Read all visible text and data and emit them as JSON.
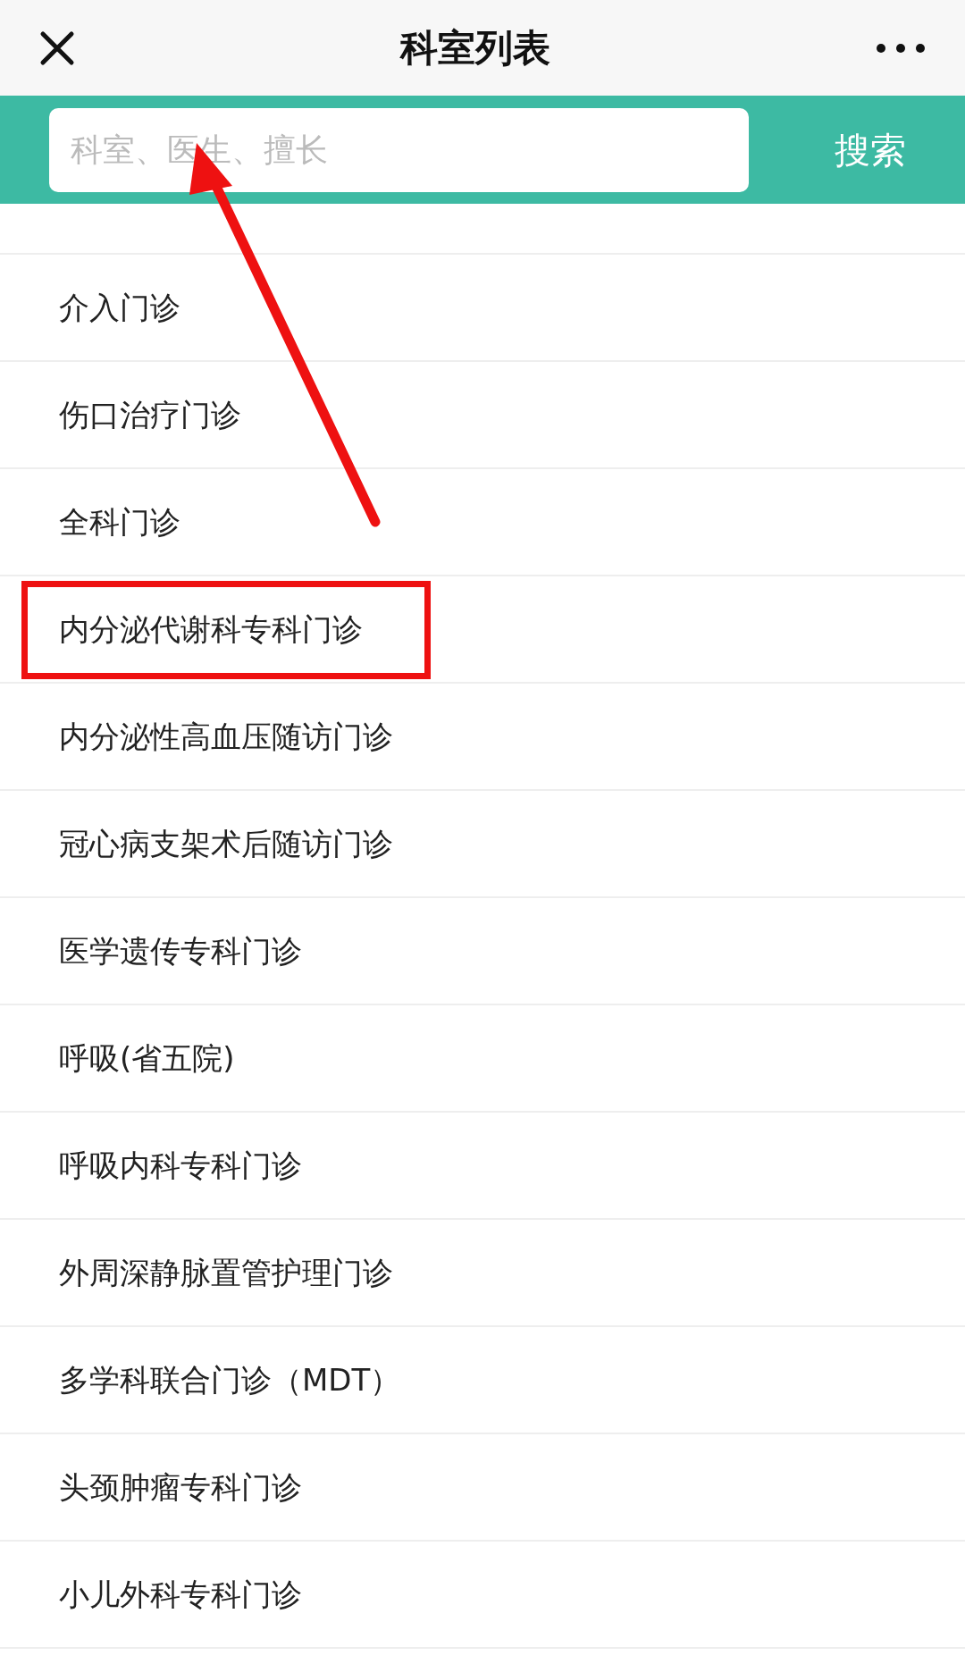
{
  "header": {
    "title": "科室列表"
  },
  "search": {
    "placeholder": "科室、医生、擅长",
    "button": "搜索"
  },
  "departments": [
    {
      "name": "介入门诊",
      "highlighted": false
    },
    {
      "name": "伤口治疗门诊",
      "highlighted": false
    },
    {
      "name": "全科门诊",
      "highlighted": false
    },
    {
      "name": "内分泌代谢科专科门诊",
      "highlighted": true
    },
    {
      "name": "内分泌性高血压随访门诊",
      "highlighted": false
    },
    {
      "name": "冠心病支架术后随访门诊",
      "highlighted": false
    },
    {
      "name": "医学遗传专科门诊",
      "highlighted": false
    },
    {
      "name": "呼吸(省五院)",
      "highlighted": false
    },
    {
      "name": "呼吸内科专科门诊",
      "highlighted": false
    },
    {
      "name": "外周深静脉置管护理门诊",
      "highlighted": false
    },
    {
      "name": "多学科联合门诊（MDT）",
      "highlighted": false
    },
    {
      "name": "头颈肿瘤专科门诊",
      "highlighted": false
    },
    {
      "name": "小儿外科专科门诊",
      "highlighted": false
    }
  ]
}
